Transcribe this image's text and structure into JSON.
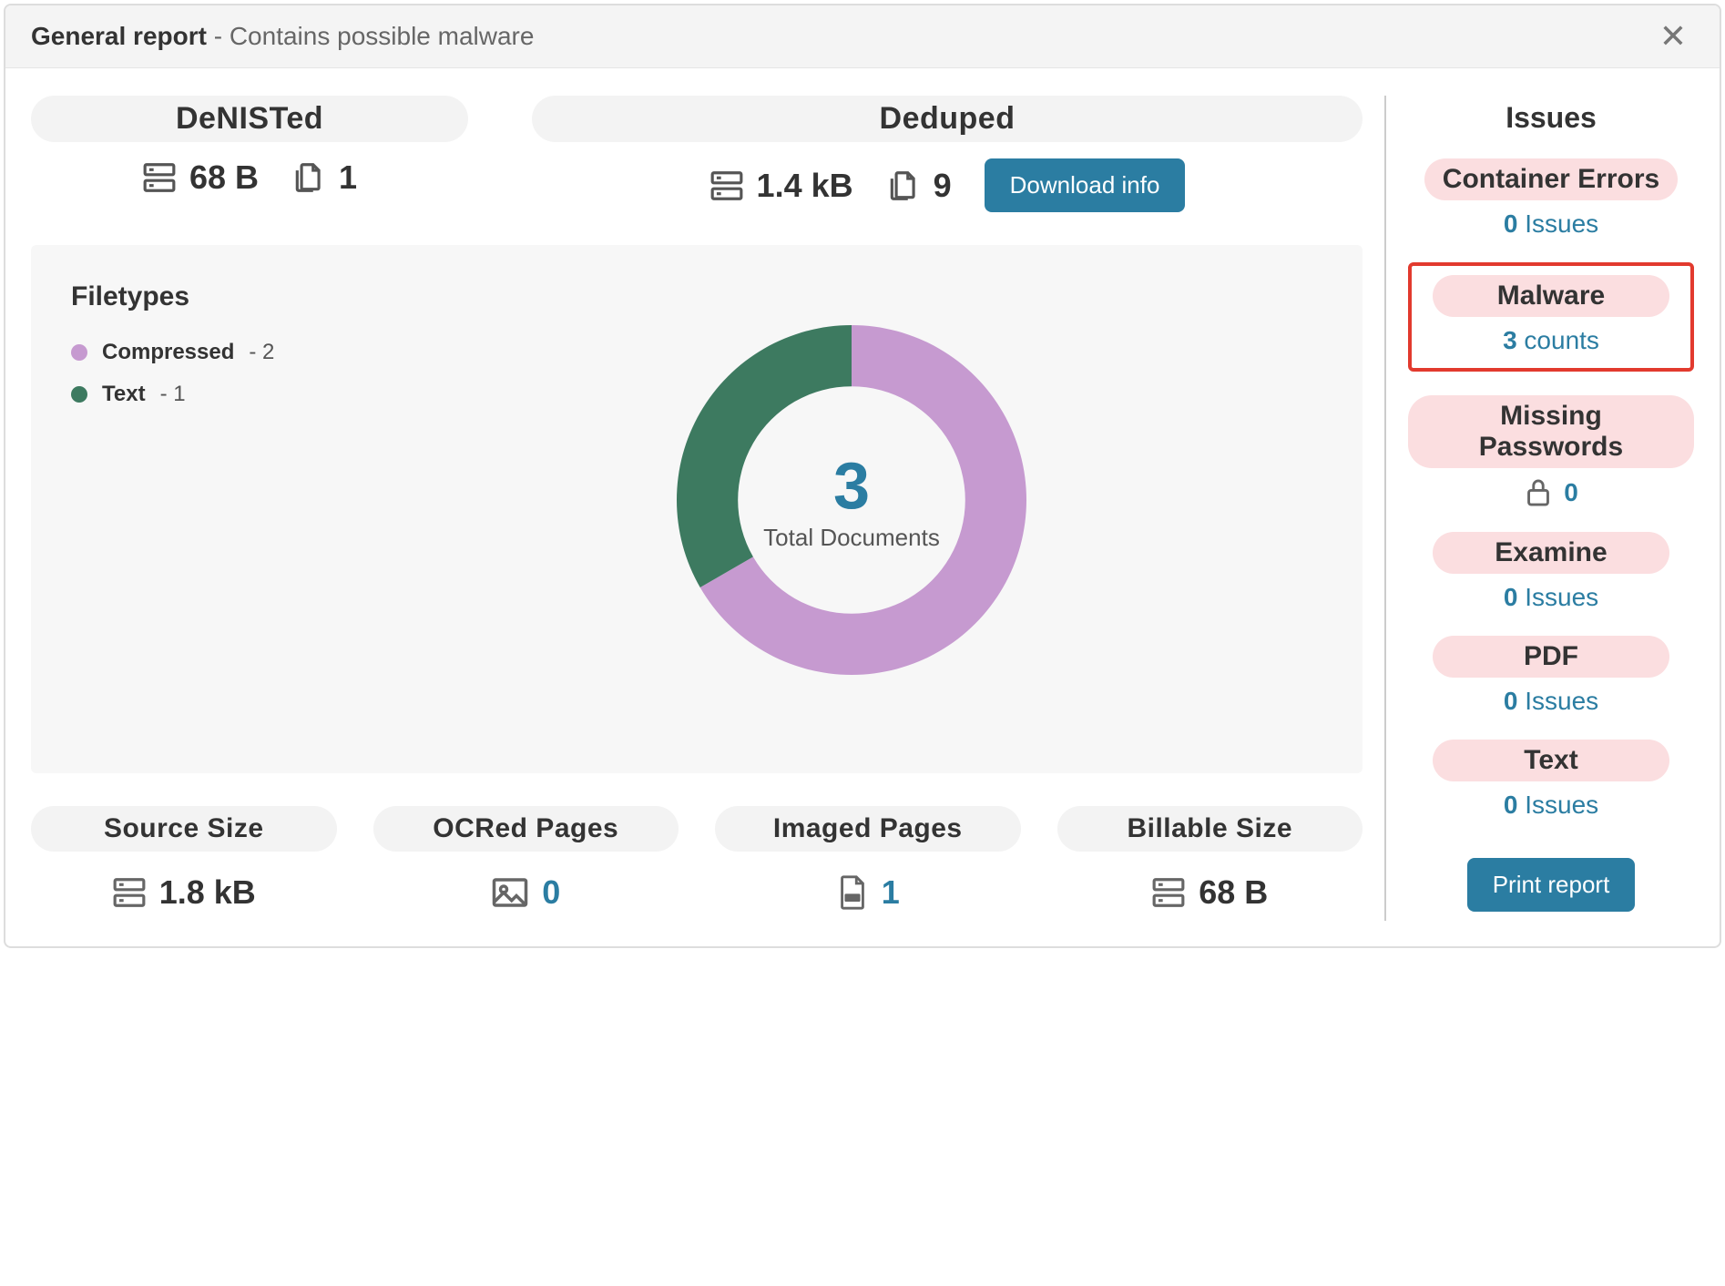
{
  "header": {
    "title_strong": "General report",
    "title_sub": " - Contains possible malware"
  },
  "top": {
    "denisted": {
      "label": "DeNISTed",
      "size": "68 B",
      "docs": "1"
    },
    "deduped": {
      "label": "Deduped",
      "size": "1.4 kB",
      "docs": "9",
      "download_label": "Download info"
    }
  },
  "filetypes": {
    "title": "Filetypes",
    "items": [
      {
        "label": "Compressed",
        "count": "2",
        "color": "#c69ad0"
      },
      {
        "label": "Text",
        "count": "1",
        "color": "#3d7a60"
      }
    ],
    "total_num": "3",
    "total_label": "Total Documents"
  },
  "bottom": [
    {
      "label": "Source Size",
      "value": "1.8 kB",
      "icon": "server",
      "teal": false
    },
    {
      "label": "OCRed Pages",
      "value": "0",
      "icon": "image",
      "teal": true
    },
    {
      "label": "Imaged Pages",
      "value": "1",
      "icon": "pdf",
      "teal": true
    },
    {
      "label": "Billable Size",
      "value": "68 B",
      "icon": "server",
      "teal": false
    }
  ],
  "issues": {
    "title": "Issues",
    "items": [
      {
        "label": "Container Errors",
        "count": "0",
        "unit": "Issues",
        "highlight": false,
        "icon": null
      },
      {
        "label": "Malware",
        "count": "3",
        "unit": "counts",
        "highlight": true,
        "icon": null
      },
      {
        "label": "Missing Passwords",
        "count": "0",
        "unit": "",
        "highlight": false,
        "icon": "lock"
      },
      {
        "label": "Examine",
        "count": "0",
        "unit": "Issues",
        "highlight": false,
        "icon": null
      },
      {
        "label": "PDF",
        "count": "0",
        "unit": "Issues",
        "highlight": false,
        "icon": null
      },
      {
        "label": "Text",
        "count": "0",
        "unit": "Issues",
        "highlight": false,
        "icon": null
      }
    ],
    "print_label": "Print report"
  },
  "chart_data": {
    "type": "pie",
    "title": "Filetypes",
    "categories": [
      "Compressed",
      "Text"
    ],
    "values": [
      2,
      1
    ],
    "colors": [
      "#c69ad0",
      "#3d7a60"
    ],
    "center_value": 3,
    "center_label": "Total Documents"
  }
}
